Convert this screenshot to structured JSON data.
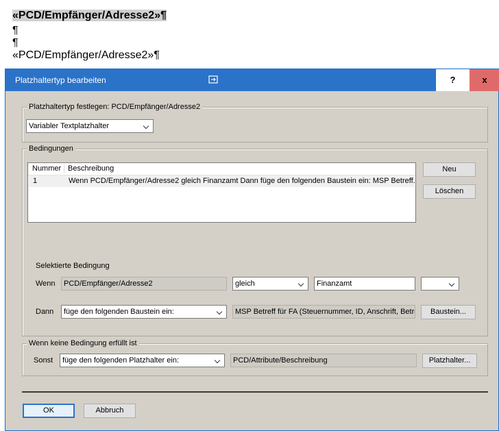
{
  "document": {
    "line1": "«PCD/Empfänger/Adresse2»¶",
    "line2": "¶",
    "line3": "¶",
    "line4": "«PCD/Empfänger/Adresse2»¶"
  },
  "dialog": {
    "title": "Platzhaltertyp bearbeiten",
    "help": "?",
    "close": "x",
    "type_group": {
      "legend": "Platzhaltertyp festlegen: PCD/Empfänger/Adresse2",
      "type_select": "Variabler Textplatzhalter"
    },
    "conditions_group": {
      "legend": "Bedingungen",
      "columns": [
        "Nummer",
        "Beschreibung"
      ],
      "rows": [
        {
          "number": "1",
          "description": "Wenn PCD/Empfänger/Adresse2 gleich Finanzamt Dann füge den folgenden Baustein ein:  MSP Betreff..."
        }
      ],
      "new_button": "Neu",
      "delete_button": "Löschen",
      "selected_label": "Selektierte Bedingung",
      "if_label": "Wenn",
      "if_field": "PCD/Empfänger/Adresse2",
      "operator": "gleich",
      "value": "Finanzamt",
      "extra_select": "",
      "then_label": "Dann",
      "then_action": "füge den folgenden Baustein ein:",
      "then_value": "MSP Betreff für FA (Steuernummer, ID, Anschrift, Betreff)",
      "block_button": "Baustein..."
    },
    "else_group": {
      "legend": "Wenn keine Bedingung erfüllt ist",
      "else_label": "Sonst",
      "else_action": "füge den folgenden Platzhalter ein:",
      "else_value": "PCD/Attribute/Beschreibung",
      "placeholder_button": "Platzhalter..."
    },
    "ok_button": "OK",
    "cancel_button": "Abbruch"
  }
}
